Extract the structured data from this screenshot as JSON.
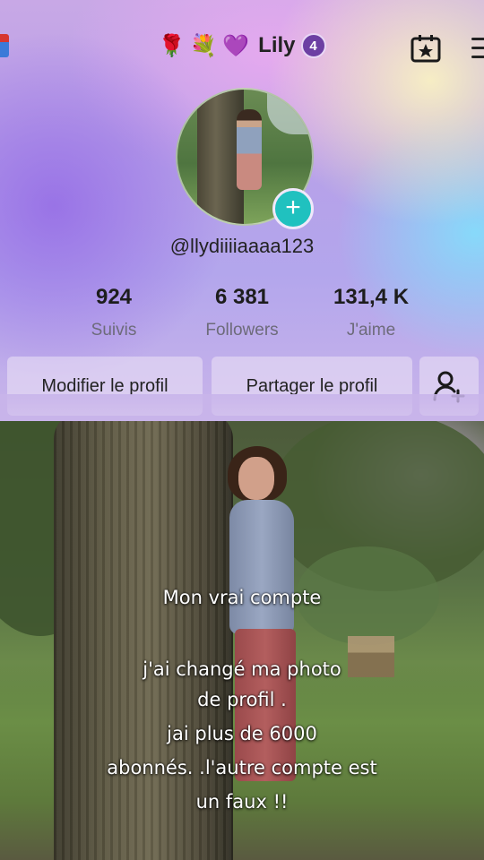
{
  "header": {
    "emojis": [
      "🌹",
      "💐",
      "💜"
    ],
    "username": "Lily",
    "notification_count": "4",
    "icons": [
      "gift-icon",
      "calendar-star-icon",
      "menu-icon"
    ]
  },
  "profile": {
    "handle": "@llydiiiiaaaa123",
    "stats": [
      {
        "value": "924",
        "label": "Suivis"
      },
      {
        "value": "6 381",
        "label": "Followers"
      },
      {
        "value": "131,4 K",
        "label": "J'aime"
      }
    ],
    "buttons": {
      "edit": "Modifier le profil",
      "share": "Partager le profil"
    }
  },
  "caption": {
    "line1": "Mon vrai compte",
    "line2": "j'ai changé ma photo",
    "line3": "de profil .",
    "line4": "jai  plus de 6000",
    "line5": "abonnés. .l'autre compte est",
    "line6": "un faux !!"
  },
  "colors": {
    "accent_teal": "#20c1bf",
    "badge_purple": "#6c3fa3"
  }
}
